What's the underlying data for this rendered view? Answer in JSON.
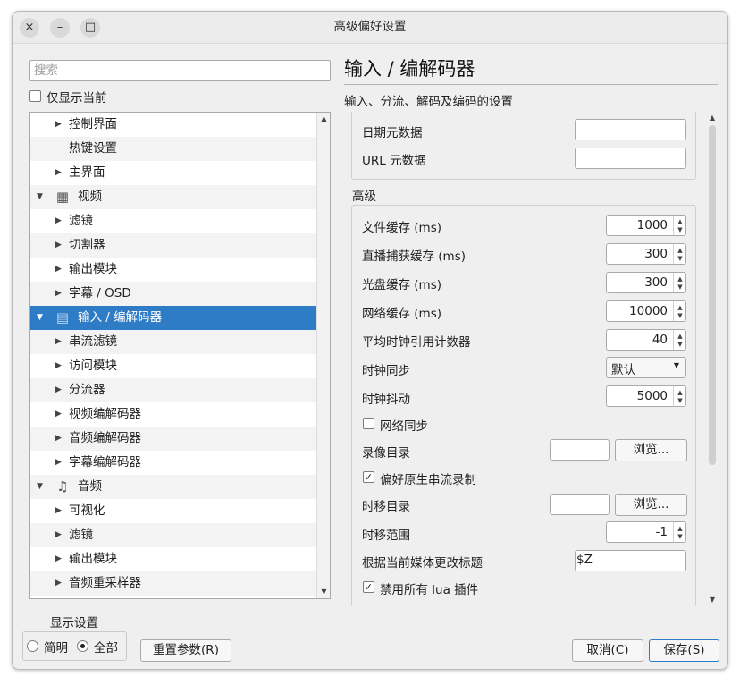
{
  "window": {
    "title": "高级偏好设置",
    "controls": [
      "×",
      "–",
      "□"
    ]
  },
  "search": {
    "placeholder": "搜索",
    "value": ""
  },
  "only_current": {
    "label": "仅显示当前",
    "checked": false
  },
  "tree": [
    {
      "label": "控制界面",
      "level": 1,
      "expander": "right"
    },
    {
      "label": "热键设置",
      "level": 1,
      "expander": "none"
    },
    {
      "label": "主界面",
      "level": 1,
      "expander": "right"
    },
    {
      "label": "视频",
      "level": 0,
      "expander": "down",
      "icon": "video-settings-icon"
    },
    {
      "label": "滤镜",
      "level": 1,
      "expander": "right"
    },
    {
      "label": "切割器",
      "level": 1,
      "expander": "right"
    },
    {
      "label": "输出模块",
      "level": 1,
      "expander": "right"
    },
    {
      "label": "字幕 / OSD",
      "level": 1,
      "expander": "right"
    },
    {
      "label": "输入 / 编解码器",
      "level": 0,
      "expander": "down",
      "icon": "codec-icon",
      "selected": true
    },
    {
      "label": "串流滤镜",
      "level": 1,
      "expander": "right"
    },
    {
      "label": "访问模块",
      "level": 1,
      "expander": "right"
    },
    {
      "label": "分流器",
      "level": 1,
      "expander": "right"
    },
    {
      "label": "视频编解码器",
      "level": 1,
      "expander": "right"
    },
    {
      "label": "音频编解码器",
      "level": 1,
      "expander": "right"
    },
    {
      "label": "字幕编解码器",
      "level": 1,
      "expander": "right"
    },
    {
      "label": "音频",
      "level": 0,
      "expander": "down",
      "icon": "music-note-icon"
    },
    {
      "label": "可视化",
      "level": 1,
      "expander": "right"
    },
    {
      "label": "滤镜",
      "level": 1,
      "expander": "right"
    },
    {
      "label": "输出模块",
      "level": 1,
      "expander": "right"
    },
    {
      "label": "音频重采样器",
      "level": 1,
      "expander": "right"
    }
  ],
  "panel": {
    "title": "输入 / 编解码器",
    "subtitle": "输入、分流、解码及编码的设置",
    "top_fields": [
      {
        "label": "日期元数据",
        "value": ""
      },
      {
        "label": "URL 元数据",
        "value": ""
      }
    ],
    "advanced_label": "高级",
    "spin_fields": [
      {
        "label": "文件缓存 (ms)",
        "value": "1000"
      },
      {
        "label": "直播捕获缓存 (ms)",
        "value": "300"
      },
      {
        "label": "光盘缓存 (ms)",
        "value": "300"
      },
      {
        "label": "网络缓存 (ms)",
        "value": "10000"
      },
      {
        "label": "平均时钟引用计数器",
        "value": "40"
      }
    ],
    "clock_sync": {
      "label": "时钟同步",
      "value": "默认"
    },
    "clock_jitter": {
      "label": "时钟抖动",
      "value": "5000"
    },
    "network_sync": {
      "label": "网络同步",
      "checked": false
    },
    "record_dir": {
      "label": "录像目录",
      "value": "",
      "browse": "浏览..."
    },
    "prefer_native": {
      "label": "偏好原生串流录制",
      "checked": true
    },
    "timeshift_dir": {
      "label": "时移目录",
      "value": "",
      "browse": "浏览..."
    },
    "timeshift_range": {
      "label": "时移范围",
      "value": "-1"
    },
    "title_format": {
      "label": "根据当前媒体更改标题",
      "value": "$Z"
    },
    "disable_lua": {
      "label": "禁用所有 lua 插件",
      "checked": true
    }
  },
  "footer": {
    "show_settings": "显示设置",
    "simple": "简明",
    "all": "全部",
    "selected_mode": "all",
    "reset": {
      "text": "重置参数(",
      "key": "R",
      "close": ")"
    },
    "cancel": {
      "text": "取消(",
      "key": "C",
      "close": ")"
    },
    "save": {
      "text": "保存(",
      "key": "S",
      "close": ")"
    }
  },
  "colors": {
    "selection": "#2e7bc6",
    "window_bg": "#efefef"
  }
}
